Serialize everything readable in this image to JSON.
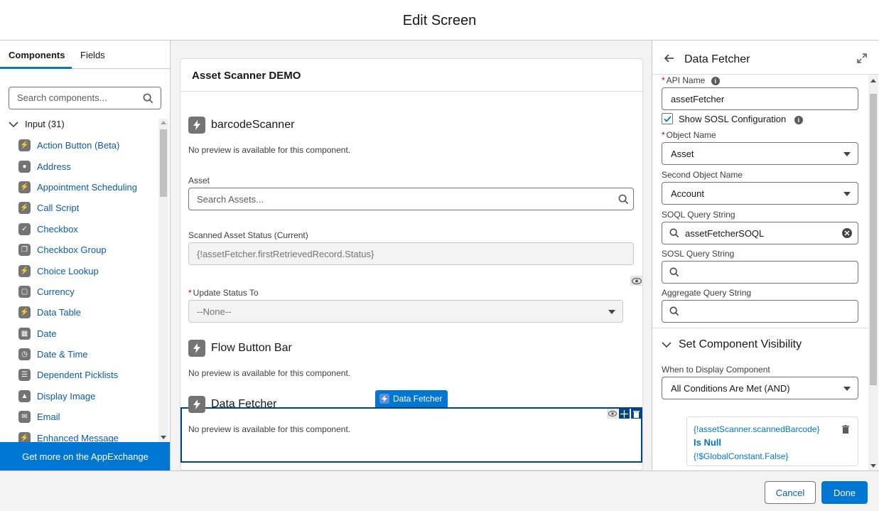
{
  "header": {
    "title": "Edit Screen"
  },
  "left_panel": {
    "tabs": [
      {
        "label": "Components",
        "active": true
      },
      {
        "label": "Fields",
        "active": false
      }
    ],
    "search": {
      "placeholder": "Search components..."
    },
    "group": {
      "label": "Input (31)"
    },
    "items": [
      {
        "label": "Action Button (Beta)",
        "icon": "flow-icon"
      },
      {
        "label": "Address",
        "icon": "location-icon"
      },
      {
        "label": "Appointment Scheduling",
        "icon": "flow-icon"
      },
      {
        "label": "Call Script",
        "icon": "flow-icon"
      },
      {
        "label": "Checkbox",
        "icon": "checkbox-icon"
      },
      {
        "label": "Checkbox Group",
        "icon": "checkbox-group-icon"
      },
      {
        "label": "Choice Lookup",
        "icon": "flow-icon"
      },
      {
        "label": "Currency",
        "icon": "currency-icon"
      },
      {
        "label": "Data Table",
        "icon": "flow-icon"
      },
      {
        "label": "Date",
        "icon": "calendar-icon"
      },
      {
        "label": "Date & Time",
        "icon": "datetime-icon"
      },
      {
        "label": "Dependent Picklists",
        "icon": "list-icon"
      },
      {
        "label": "Display Image",
        "icon": "image-icon"
      },
      {
        "label": "Email",
        "icon": "email-icon"
      },
      {
        "label": "Enhanced Message",
        "icon": "flow-icon"
      }
    ],
    "appexchange_label": "Get more on the AppExchange"
  },
  "canvas": {
    "screen_title": "Asset Scanner DEMO",
    "components": {
      "barcode": {
        "title": "barcodeScanner",
        "note": "No preview is available for this component."
      },
      "asset": {
        "label": "Asset",
        "placeholder": "Search Assets..."
      },
      "status": {
        "label": "Scanned Asset Status (Current)",
        "value": "{!assetFetcher.firstRetrievedRecord.Status}"
      },
      "update": {
        "label": "Update Status To",
        "value": "--None--"
      },
      "buttonbar": {
        "title": "Flow Button Bar",
        "note": "No preview is available for this component."
      },
      "fetcher": {
        "title": "Data Fetcher",
        "note": "No preview is available for this component.",
        "tag": "Data Fetcher"
      }
    }
  },
  "right_panel": {
    "title": "Data Fetcher",
    "api_name": {
      "label": "API Name",
      "value": "assetFetcher"
    },
    "show_sosl": {
      "label": "Show SOSL Configuration",
      "checked": true
    },
    "object_name": {
      "label": "Object Name",
      "value": "Asset"
    },
    "second_object": {
      "label": "Second Object Name",
      "value": "Account"
    },
    "soql": {
      "label": "SOQL Query String",
      "value": "assetFetcherSOQL"
    },
    "sosl": {
      "label": "SOSL Query String",
      "value": ""
    },
    "aggregate": {
      "label": "Aggregate Query String",
      "value": ""
    },
    "visibility": {
      "heading": "Set Component Visibility",
      "when_label": "When to Display Component",
      "when_value": "All Conditions Are Met (AND)",
      "condition": {
        "resource": "{!assetScanner.scannedBarcode}",
        "operator": "Is Null",
        "value": "{!$GlobalConstant.False}"
      }
    }
  },
  "footer": {
    "cancel": "Cancel",
    "done": "Done"
  },
  "colors": {
    "brand": "#0176d3",
    "link": "#0b5cab",
    "selection": "#014486"
  }
}
